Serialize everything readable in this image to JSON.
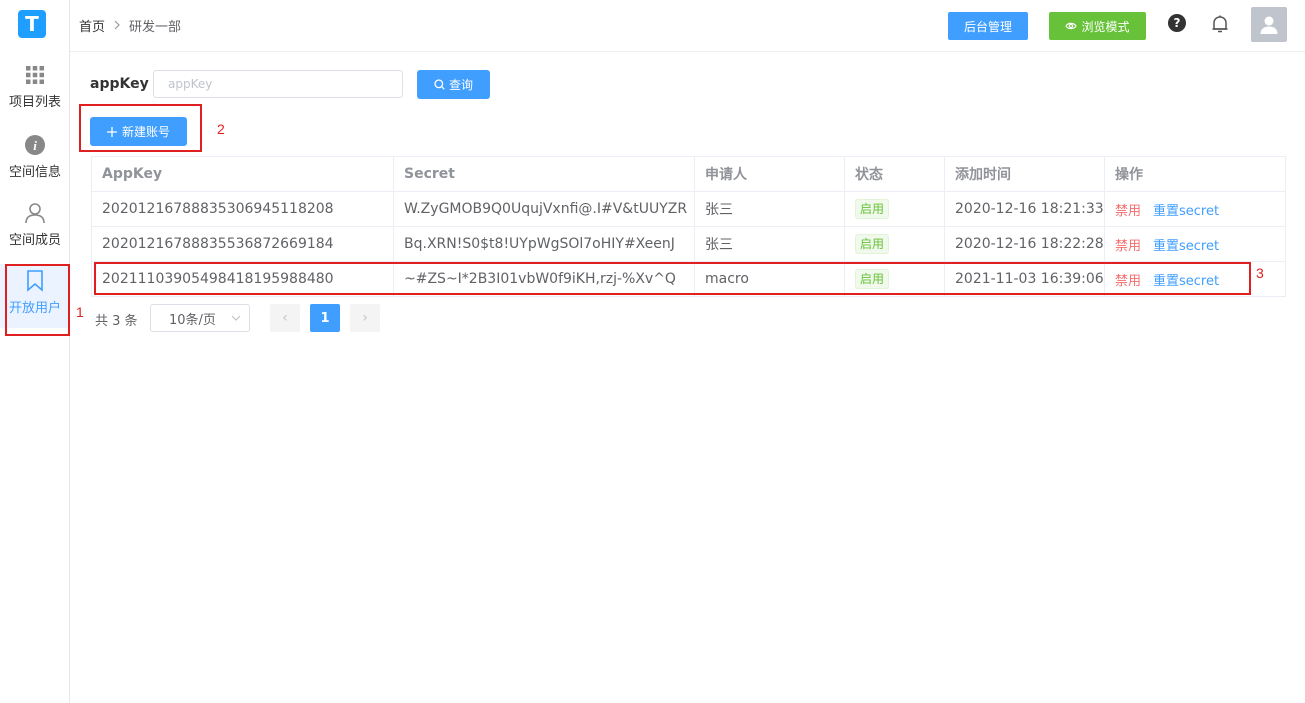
{
  "sidebar": {
    "logo_letter": "T",
    "items": [
      {
        "label": "项目列表",
        "icon": "grid-icon"
      },
      {
        "label": "空间信息",
        "icon": "info-icon"
      },
      {
        "label": "空间成员",
        "icon": "user-icon"
      },
      {
        "label": "开放用户",
        "icon": "bookmark-icon",
        "active": true
      }
    ]
  },
  "header": {
    "breadcrumb": [
      "首页",
      "研发一部"
    ],
    "admin_label": "后台管理",
    "view_mode_label": "浏览模式",
    "help_glyph": "?"
  },
  "filter": {
    "label": "appKey",
    "placeholder": "appKey",
    "value": "",
    "query_label": "查询"
  },
  "new_account_label": "新建账号",
  "annotations": [
    "1",
    "2",
    "3"
  ],
  "table": {
    "columns": [
      "AppKey",
      "Secret",
      "申请人",
      "状态",
      "添加时间",
      "操作"
    ],
    "rows": [
      {
        "appkey": "20201216788835306945118208",
        "secret": "W.ZyGMOB9Q0UqujVxnfi@.I#V&tUUYZR",
        "applicant": "张三",
        "status": "启用",
        "time": "2020-12-16 18:21:33"
      },
      {
        "appkey": "20201216788835536872669184",
        "secret": "Bq.XRN!S0$t8!UYpWgSOl7oHIY#XeenJ",
        "applicant": "张三",
        "status": "启用",
        "time": "2020-12-16 18:22:28"
      },
      {
        "appkey": "20211103905498418195988480",
        "secret": "~#ZS~I*2B3I01vbW0f9iKH,rzj-%Xv^Q",
        "applicant": "macro",
        "status": "启用",
        "time": "2021-11-03 16:39:06"
      }
    ],
    "action_disable": "禁用",
    "action_reset": "重置secret"
  },
  "pagination": {
    "total_text": "共 3 条",
    "page_size": "10条/页",
    "current_page": "1",
    "prev_glyph": "‹",
    "next_glyph": "›"
  },
  "colors": {
    "primary": "#409eff",
    "success": "#67c23a",
    "danger": "#f56c6c",
    "annotation": "#e02020"
  }
}
